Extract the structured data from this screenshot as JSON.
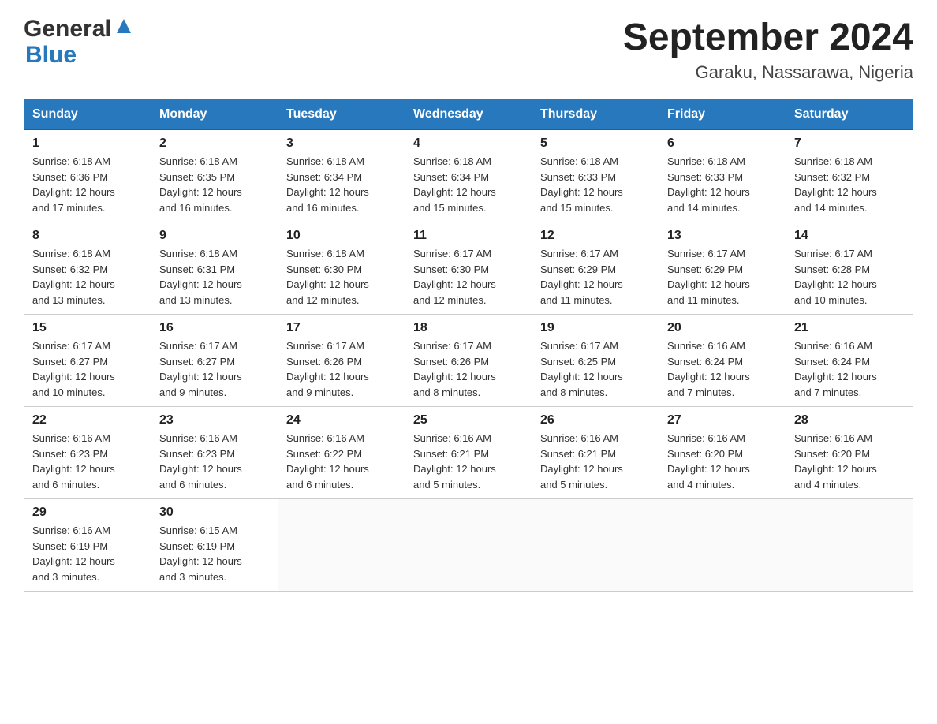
{
  "header": {
    "logo_general": "General",
    "logo_blue": "Blue",
    "month_title": "September 2024",
    "location": "Garaku, Nassarawa, Nigeria"
  },
  "weekdays": [
    "Sunday",
    "Monday",
    "Tuesday",
    "Wednesday",
    "Thursday",
    "Friday",
    "Saturday"
  ],
  "weeks": [
    [
      {
        "day": "1",
        "sunrise": "6:18 AM",
        "sunset": "6:36 PM",
        "daylight": "12 hours and 17 minutes."
      },
      {
        "day": "2",
        "sunrise": "6:18 AM",
        "sunset": "6:35 PM",
        "daylight": "12 hours and 16 minutes."
      },
      {
        "day": "3",
        "sunrise": "6:18 AM",
        "sunset": "6:34 PM",
        "daylight": "12 hours and 16 minutes."
      },
      {
        "day": "4",
        "sunrise": "6:18 AM",
        "sunset": "6:34 PM",
        "daylight": "12 hours and 15 minutes."
      },
      {
        "day": "5",
        "sunrise": "6:18 AM",
        "sunset": "6:33 PM",
        "daylight": "12 hours and 15 minutes."
      },
      {
        "day": "6",
        "sunrise": "6:18 AM",
        "sunset": "6:33 PM",
        "daylight": "12 hours and 14 minutes."
      },
      {
        "day": "7",
        "sunrise": "6:18 AM",
        "sunset": "6:32 PM",
        "daylight": "12 hours and 14 minutes."
      }
    ],
    [
      {
        "day": "8",
        "sunrise": "6:18 AM",
        "sunset": "6:32 PM",
        "daylight": "12 hours and 13 minutes."
      },
      {
        "day": "9",
        "sunrise": "6:18 AM",
        "sunset": "6:31 PM",
        "daylight": "12 hours and 13 minutes."
      },
      {
        "day": "10",
        "sunrise": "6:18 AM",
        "sunset": "6:30 PM",
        "daylight": "12 hours and 12 minutes."
      },
      {
        "day": "11",
        "sunrise": "6:17 AM",
        "sunset": "6:30 PM",
        "daylight": "12 hours and 12 minutes."
      },
      {
        "day": "12",
        "sunrise": "6:17 AM",
        "sunset": "6:29 PM",
        "daylight": "12 hours and 11 minutes."
      },
      {
        "day": "13",
        "sunrise": "6:17 AM",
        "sunset": "6:29 PM",
        "daylight": "12 hours and 11 minutes."
      },
      {
        "day": "14",
        "sunrise": "6:17 AM",
        "sunset": "6:28 PM",
        "daylight": "12 hours and 10 minutes."
      }
    ],
    [
      {
        "day": "15",
        "sunrise": "6:17 AM",
        "sunset": "6:27 PM",
        "daylight": "12 hours and 10 minutes."
      },
      {
        "day": "16",
        "sunrise": "6:17 AM",
        "sunset": "6:27 PM",
        "daylight": "12 hours and 9 minutes."
      },
      {
        "day": "17",
        "sunrise": "6:17 AM",
        "sunset": "6:26 PM",
        "daylight": "12 hours and 9 minutes."
      },
      {
        "day": "18",
        "sunrise": "6:17 AM",
        "sunset": "6:26 PM",
        "daylight": "12 hours and 8 minutes."
      },
      {
        "day": "19",
        "sunrise": "6:17 AM",
        "sunset": "6:25 PM",
        "daylight": "12 hours and 8 minutes."
      },
      {
        "day": "20",
        "sunrise": "6:16 AM",
        "sunset": "6:24 PM",
        "daylight": "12 hours and 7 minutes."
      },
      {
        "day": "21",
        "sunrise": "6:16 AM",
        "sunset": "6:24 PM",
        "daylight": "12 hours and 7 minutes."
      }
    ],
    [
      {
        "day": "22",
        "sunrise": "6:16 AM",
        "sunset": "6:23 PM",
        "daylight": "12 hours and 6 minutes."
      },
      {
        "day": "23",
        "sunrise": "6:16 AM",
        "sunset": "6:23 PM",
        "daylight": "12 hours and 6 minutes."
      },
      {
        "day": "24",
        "sunrise": "6:16 AM",
        "sunset": "6:22 PM",
        "daylight": "12 hours and 6 minutes."
      },
      {
        "day": "25",
        "sunrise": "6:16 AM",
        "sunset": "6:21 PM",
        "daylight": "12 hours and 5 minutes."
      },
      {
        "day": "26",
        "sunrise": "6:16 AM",
        "sunset": "6:21 PM",
        "daylight": "12 hours and 5 minutes."
      },
      {
        "day": "27",
        "sunrise": "6:16 AM",
        "sunset": "6:20 PM",
        "daylight": "12 hours and 4 minutes."
      },
      {
        "day": "28",
        "sunrise": "6:16 AM",
        "sunset": "6:20 PM",
        "daylight": "12 hours and 4 minutes."
      }
    ],
    [
      {
        "day": "29",
        "sunrise": "6:16 AM",
        "sunset": "6:19 PM",
        "daylight": "12 hours and 3 minutes."
      },
      {
        "day": "30",
        "sunrise": "6:15 AM",
        "sunset": "6:19 PM",
        "daylight": "12 hours and 3 minutes."
      },
      null,
      null,
      null,
      null,
      null
    ]
  ],
  "labels": {
    "sunrise": "Sunrise:",
    "sunset": "Sunset:",
    "daylight": "Daylight:"
  }
}
